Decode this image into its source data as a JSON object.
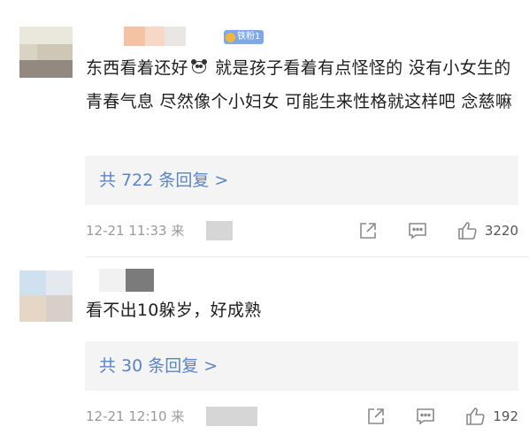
{
  "comments": [
    {
      "fan_badge": "铁粉1",
      "text_part1": "东西看着还好",
      "emoji": "panda-icon",
      "text_part2": " 就是孩子看着有点怪怪的 没有小女生的青春气息 尽然像个小妇女 可能生来性格就这样吧 念慈嘛",
      "reply_link": "共 722 条回复 >",
      "time": "12-21 11:33 来",
      "likes": "3220"
    },
    {
      "text": "看不出10躲岁，好成熟",
      "reply_link": "共 30 条回复 >",
      "time": "12-21 12:10 来",
      "likes": "192"
    }
  ],
  "colors": {
    "link": "#5a84c6",
    "meta_text": "#9a9a9a",
    "reply_bg": "#f4f4f4",
    "fan_badge": "#7ea8e6"
  },
  "icons": [
    "share-icon",
    "comment-icon",
    "thumbs-up-icon",
    "panda-icon",
    "fan-badge-icon"
  ]
}
